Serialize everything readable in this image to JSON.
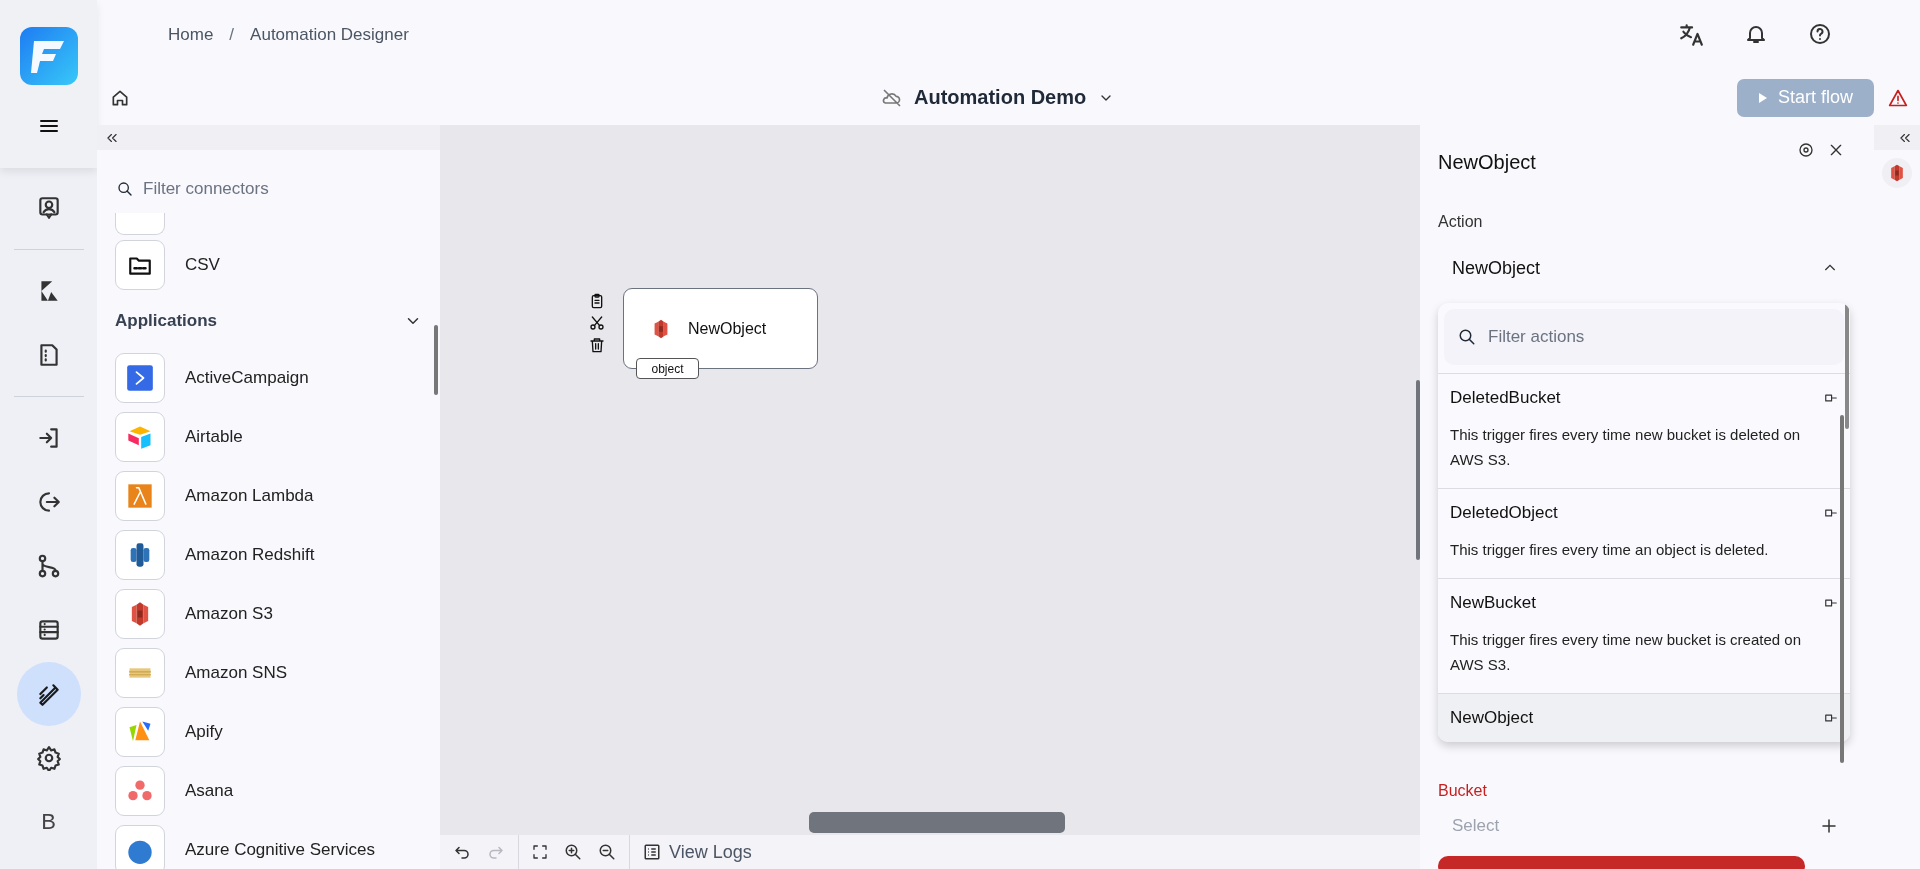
{
  "breadcrumb": {
    "items": [
      {
        "label": "Home"
      },
      {
        "label": "Automation Designer"
      }
    ],
    "separator": "/"
  },
  "rail": {
    "items": [
      {
        "kind": "profile",
        "selected": false
      },
      {
        "kind": "k",
        "selected": false
      },
      {
        "kind": "document",
        "selected": false
      },
      {
        "kind": "login",
        "selected": false
      },
      {
        "kind": "logout",
        "selected": false
      },
      {
        "kind": "flow",
        "selected": false
      },
      {
        "kind": "table",
        "selected": false
      },
      {
        "kind": "designer",
        "selected": true
      },
      {
        "kind": "settings",
        "selected": false
      },
      {
        "kind": "letter",
        "label": "B",
        "selected": false
      }
    ]
  },
  "flow": {
    "title": "Automation Demo"
  },
  "start_button": {
    "label": "Start flow",
    "disabled": true
  },
  "connectors": {
    "placeholder": "Filter connectors",
    "top_items": [
      {
        "label": "CSV",
        "kind": "csv"
      }
    ],
    "section": {
      "title": "Applications",
      "expanded": true,
      "items": [
        {
          "label": "ActiveCampaign",
          "kind": "activecampaign"
        },
        {
          "label": "Airtable",
          "kind": "airtable"
        },
        {
          "label": "Amazon Lambda",
          "kind": "lambda"
        },
        {
          "label": "Amazon Redshift",
          "kind": "redshift"
        },
        {
          "label": "Amazon S3",
          "kind": "s3"
        },
        {
          "label": "Amazon SNS",
          "kind": "sns"
        },
        {
          "label": "Apify",
          "kind": "apify"
        },
        {
          "label": "Asana",
          "kind": "asana"
        },
        {
          "label": "Azure Cognitive Services",
          "kind": "azure"
        }
      ]
    }
  },
  "canvas": {
    "node": {
      "label": "NewObject",
      "port": "object"
    }
  },
  "toolbar": {
    "undo_disabled": false,
    "redo_disabled": true,
    "view_logs": "View Logs"
  },
  "panel": {
    "title": "NewObject",
    "action_label": "Action",
    "action_value": "NewObject",
    "expanded": true,
    "filter_placeholder": "Filter actions",
    "actions": [
      {
        "name": "DeletedBucket",
        "description": "This trigger fires every time new bucket is deleted on AWS S3.",
        "selected": false
      },
      {
        "name": "DeletedObject",
        "description": "This trigger fires every time an object is deleted.",
        "selected": false
      },
      {
        "name": "NewBucket",
        "description": "This trigger fires every time new bucket is created on AWS S3.",
        "selected": false
      },
      {
        "name": "NewObject",
        "selected": true
      }
    ],
    "bucket_label": "Bucket",
    "bucket_error": true,
    "bucket_placeholder": "Select"
  }
}
